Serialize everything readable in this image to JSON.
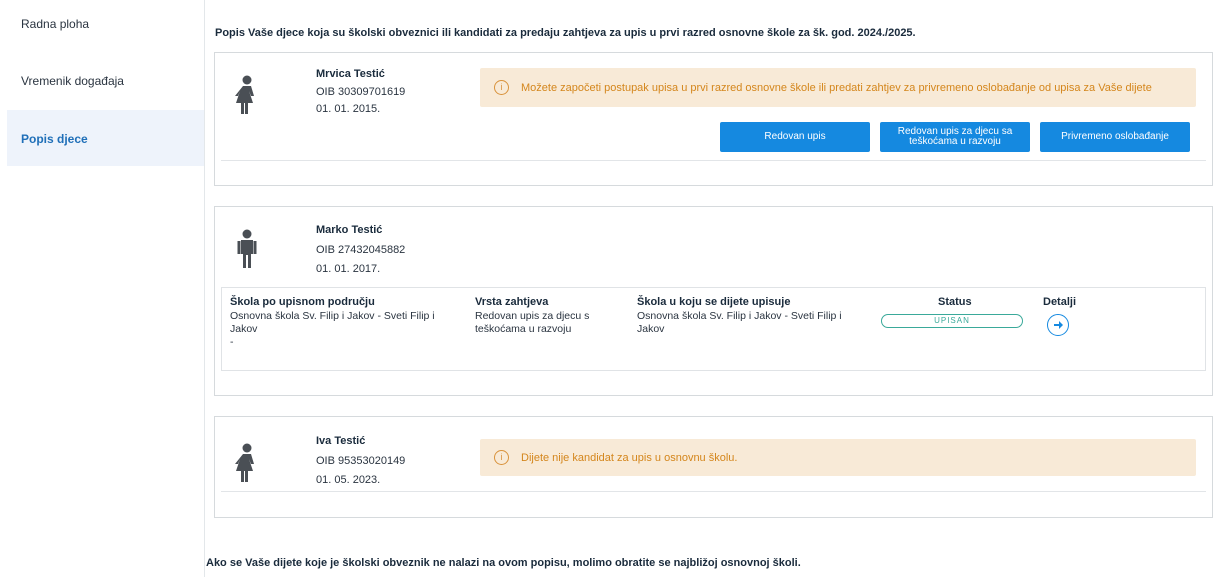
{
  "sidebar": {
    "items": [
      {
        "label": "Radna ploha",
        "active": false
      },
      {
        "label": "Vremenik događaja",
        "active": false
      },
      {
        "label": "Popis djece",
        "active": true
      }
    ]
  },
  "page_title": "Popis Vaše djece koja su školski obveznici ili kandidati za predaju zahtjeva za upis u prvi razred osnovne škole za šk. god. 2024./2025.",
  "children": [
    {
      "name": "Mrvica Testić",
      "oib": "OIB 30309701619",
      "dob": "01. 01. 2015.",
      "icon": "girl-icon",
      "alert": "Možete započeti postupak upisa u prvi razred osnovne škole ili predati zahtjev za privremeno oslobađanje od upisa za Vaše dijete",
      "buttons": {
        "regular": "Redovan upis",
        "special_line1": "Redovan upis za djecu sa",
        "special_line2": "teškoćama u razvoju",
        "exemption": "Privremeno oslobađanje"
      }
    },
    {
      "name": "Marko Testić",
      "oib": "OIB 27432045882",
      "dob": "01. 01. 2017.",
      "icon": "boy-icon",
      "enrollment": {
        "headers": {
          "district_school": "Škola po upisnom području",
          "request_type": "Vrsta zahtjeva",
          "target_school": "Škola u koju se dijete upisuje",
          "status": "Status",
          "details": "Detalji"
        },
        "district_school_line1": "Osnovna škola Sv. Filip i Jakov - Sveti Filip i",
        "district_school_line2": "Jakov",
        "district_school_line3": "-",
        "request_type_line1": "Redovan upis za djecu s",
        "request_type_line2": "teškoćama u razvoju",
        "target_school_line1": "Osnovna škola Sv. Filip i Jakov - Sveti Filip i",
        "target_school_line2": "Jakov",
        "status": "UPISAN",
        "details_icon": "arrow-right-icon"
      }
    },
    {
      "name": "Iva Testić",
      "oib": "OIB 95353020149",
      "dob": "01. 05. 2023.",
      "icon": "girl-icon",
      "alert": "Dijete nije kandidat za upis u osnovnu školu."
    }
  ],
  "footer_note": "Ako se Vaše dijete koje je školski obveznik ne nalazi na ovom popisu, molimo obratite se najbližoj osnovnoj školi.",
  "colors": {
    "primary": "#1589e0",
    "alert_bg": "#f8ead7",
    "alert_text": "#d4861c",
    "status_ok": "#3aa99a",
    "sidebar_active_bg": "#eef3fb"
  }
}
